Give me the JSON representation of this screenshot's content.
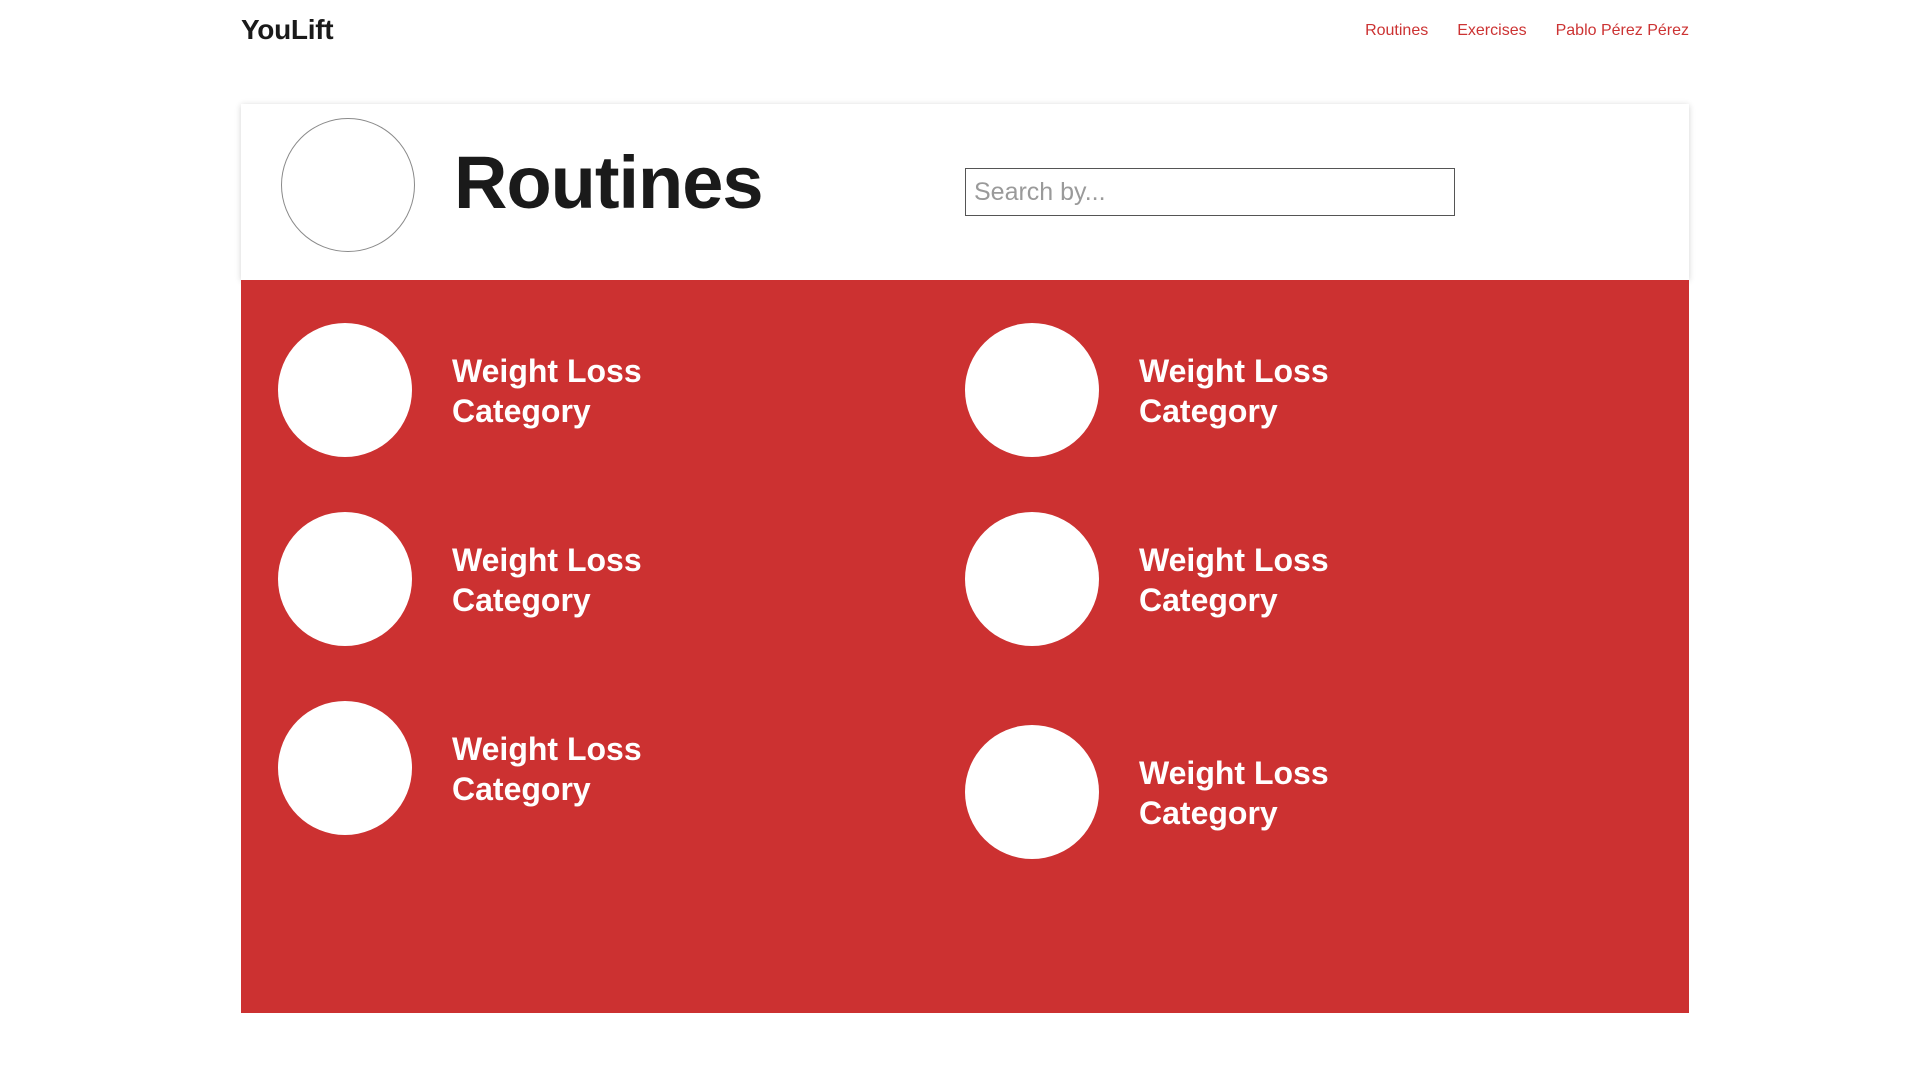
{
  "brand": "YouLift",
  "nav": {
    "routines": "Routines",
    "exercises": "Exercises",
    "user": "Pablo Pérez Pérez"
  },
  "header": {
    "title": "Routines",
    "search_placeholder": "Search by..."
  },
  "routines": [
    {
      "title": "Weight Loss Category"
    },
    {
      "title": "Weight Loss Category"
    },
    {
      "title": "Weight Loss Category"
    },
    {
      "title": "Weight Loss Category"
    },
    {
      "title": "Weight Loss Category"
    },
    {
      "title": "Weight Loss Category"
    }
  ],
  "colors": {
    "accent": "#cc3131",
    "link": "#cc3333",
    "text": "#1a1a1a"
  }
}
